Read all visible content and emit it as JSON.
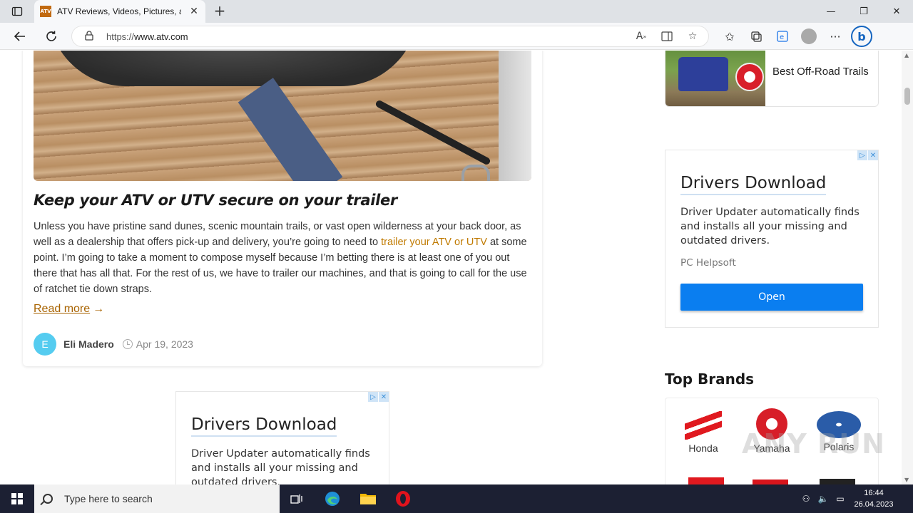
{
  "browser": {
    "tab_title": "ATV Reviews, Videos, Pictures, an",
    "tab_favicon_text": "ATV",
    "new_tab": "+",
    "url_scheme": "https://",
    "url_host": "www.atv.com"
  },
  "article": {
    "title": "Keep your ATV or UTV secure on your trailer",
    "body_before_link": "Unless you have pristine sand dunes, scenic mountain trails, or vast open wilderness at your back door, as well as a dealership that offers pick-up and delivery, you’re going to need to ",
    "body_link": "trailer your ATV or UTV",
    "body_after_link": " at some point. I’m going to take a moment to compose myself because I’m betting there is at least one of you out there that has all that. For the rest of us, we have to trailer our machines, and that is going to call for the use of ratchet tie down straps.",
    "read_more": "Read more",
    "read_more_arrow": "→",
    "author_initial": "E",
    "author_name": "Eli Madero",
    "date": "Apr 19, 2023"
  },
  "sidebar": {
    "trail_card_label": "Best Off-Road Trails",
    "top_brands_title": "Top Brands",
    "brands": [
      {
        "name": "Honda"
      },
      {
        "name": "Yamaha"
      },
      {
        "name": "Polaris"
      }
    ]
  },
  "ad_side": {
    "title": "Drivers Download",
    "text": "Driver Updater automatically finds and installs all your missing and outdated drivers.",
    "source": "PC Helpsoft",
    "button": "Open",
    "badge_info": "▷",
    "badge_close": "✕"
  },
  "ad_main": {
    "title": "Drivers Download",
    "text": "Driver Updater automatically finds and installs all your missing and outdated drivers.",
    "badge_info": "▷",
    "badge_close": "✕"
  },
  "watermark": "ANY RUN",
  "taskbar": {
    "search_placeholder": "Type here to search",
    "time": "16:44",
    "date": "26.04.2023"
  }
}
